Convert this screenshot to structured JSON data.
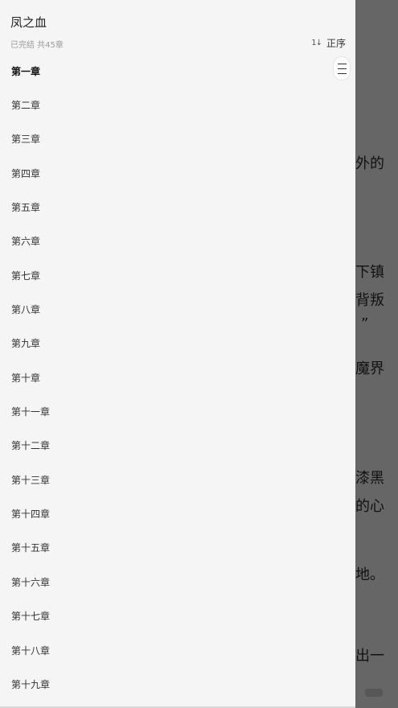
{
  "reader": {
    "lines": [
      "外的",
      "下镇",
      "背叛",
      "”",
      "魔界",
      "漆黑",
      "的心",
      "地。",
      "出一"
    ]
  },
  "drawer": {
    "title": "凤之血",
    "status": "已完结 共45章",
    "sort": {
      "icon": "1↓",
      "label": "正序"
    },
    "chapters": [
      "第一章",
      "第二章",
      "第三章",
      "第四章",
      "第五章",
      "第六章",
      "第七章",
      "第八章",
      "第九章",
      "第十章",
      "第十一章",
      "第十二章",
      "第十三章",
      "第十四章",
      "第十五章",
      "第十六章",
      "第十七章",
      "第十八章",
      "第十九章"
    ]
  }
}
